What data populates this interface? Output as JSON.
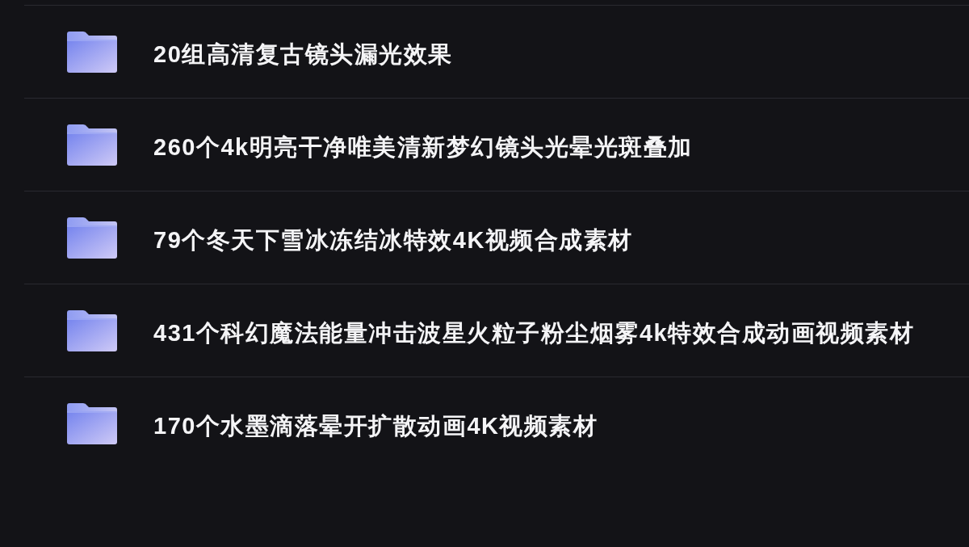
{
  "folders": [
    {
      "name": "20组高清复古镜头漏光效果"
    },
    {
      "name": "260个4k明亮干净唯美清新梦幻镜头光晕光斑叠加"
    },
    {
      "name": "79个冬天下雪冰冻结冰特效4K视频合成素材"
    },
    {
      "name": "431个科幻魔法能量冲击波星火粒子粉尘烟雾4k特效合成动画视频素材"
    },
    {
      "name": "170个水墨滴落晕开扩散动画4K视频素材"
    }
  ]
}
